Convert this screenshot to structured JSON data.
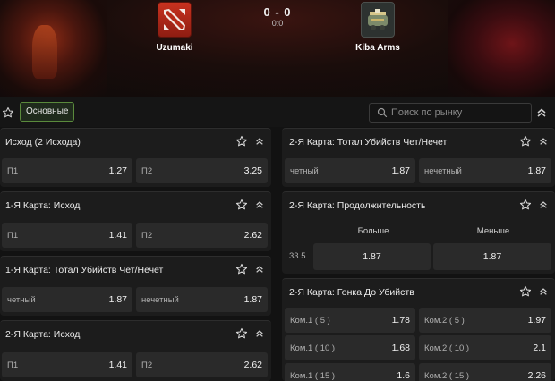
{
  "match": {
    "team1": {
      "name": "Uzumaki"
    },
    "team2": {
      "name": "Kiba Arms"
    },
    "score": "0 - 0",
    "subscore": "0:0"
  },
  "toolbar": {
    "tab_label": "Основные",
    "search_placeholder": "Поиск по рынку"
  },
  "markets": {
    "m1": {
      "title": "Исход (2 Исхода)",
      "outcomes": [
        {
          "label": "П1",
          "odd": "1.27"
        },
        {
          "label": "П2",
          "odd": "3.25"
        }
      ]
    },
    "m2": {
      "title": "1-Я Карта: Исход",
      "outcomes": [
        {
          "label": "П1",
          "odd": "1.41"
        },
        {
          "label": "П2",
          "odd": "2.62"
        }
      ]
    },
    "m3": {
      "title": "1-Я Карта: Тотал Убийств Чет/Нечет",
      "outcomes": [
        {
          "label": "четный",
          "odd": "1.87"
        },
        {
          "label": "нечетный",
          "odd": "1.87"
        }
      ]
    },
    "m4": {
      "title": "2-Я Карта: Исход",
      "outcomes": [
        {
          "label": "П1",
          "odd": "1.41"
        },
        {
          "label": "П2",
          "odd": "2.62"
        }
      ]
    },
    "m5": {
      "title": "2-Я Карта: Тотал Убийств Чет/Нечет",
      "outcomes": [
        {
          "label": "четный",
          "odd": "1.87"
        },
        {
          "label": "нечетный",
          "odd": "1.87"
        }
      ]
    },
    "m6": {
      "title": "2-Я Карта: Продолжительность",
      "col_over": "Больше",
      "col_under": "Меньше",
      "line": "33.5",
      "over_odd": "1.87",
      "under_odd": "1.87"
    },
    "m7": {
      "title": "2-Я Карта: Гонка До Убийств",
      "rows": [
        {
          "l1": "Ком.1 ( 5 )",
          "o1": "1.78",
          "l2": "Ком.2 ( 5 )",
          "o2": "1.97"
        },
        {
          "l1": "Ком.1 ( 10 )",
          "o1": "1.68",
          "l2": "Ком.2 ( 10 )",
          "o2": "2.1"
        },
        {
          "l1": "Ком.1 ( 15 )",
          "o1": "1.6",
          "l2": "Ком.2 ( 15 )",
          "o2": "2.26"
        }
      ]
    }
  },
  "colors": {
    "background": "#121212",
    "panel": "#1c1c1c",
    "odd_cell": "#2a2a2a",
    "accent": "#5a8a3c"
  },
  "icons": [
    "star-icon",
    "chevron-up-icon",
    "search-icon",
    "dota2-logo",
    "kiba-arms-logo"
  ]
}
